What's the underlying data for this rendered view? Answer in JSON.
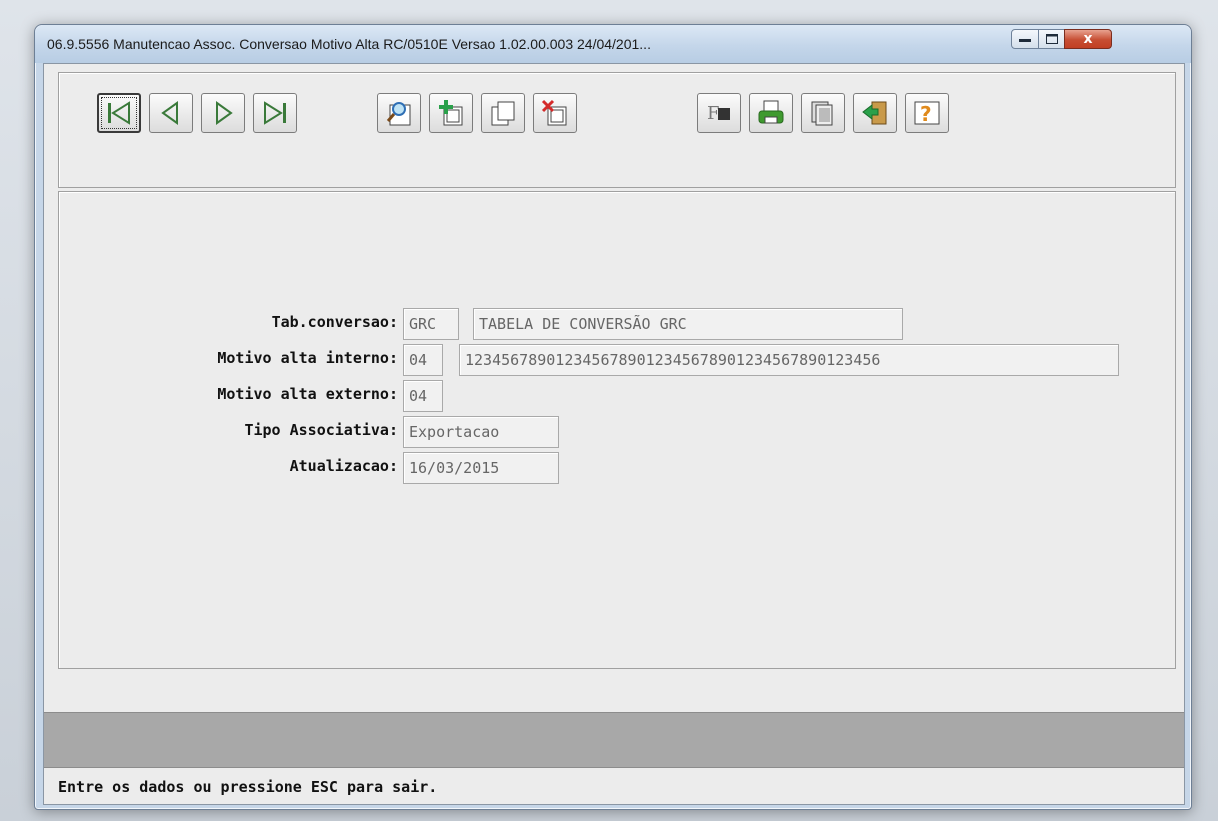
{
  "window": {
    "title": "06.9.5556 Manutencao  Assoc. Conversao Motivo Alta RC/0510E Versao 1.02.00.003 24/04/201...",
    "close_glyph": "x"
  },
  "toolbar": {
    "nav": [
      "first-icon",
      "previous-icon",
      "next-icon",
      "last-icon"
    ],
    "edit": [
      "search-icon",
      "add-icon",
      "copy-icon",
      "delete-icon"
    ],
    "extra": [
      "filter-icon",
      "print-icon",
      "pages-icon",
      "exit-icon",
      "help-icon"
    ],
    "filter_label": "F",
    "help_label": "?"
  },
  "form": {
    "tab_conversao": {
      "label": "Tab.conversao:",
      "code": "GRC",
      "description": "TABELA DE CONVERSÃO GRC"
    },
    "motivo_interno": {
      "label": "Motivo alta interno:",
      "code": "04",
      "description": "1234567890123456789012345678901234567890123456"
    },
    "motivo_externo": {
      "label": "Motivo alta externo:",
      "code": "04"
    },
    "tipo_associativa": {
      "label": "Tipo Associativa:",
      "value": "Exportacao"
    },
    "atualizacao": {
      "label": "Atualizacao:",
      "value": "16/03/2015"
    }
  },
  "status": {
    "message": "Entre os dados ou pressione ESC para sair."
  },
  "colors": {
    "accent_green": "#3f9a2f",
    "help_orange": "#e08a1c",
    "delete_red": "#d42a2a",
    "icon_blue": "#2f6fb5"
  }
}
